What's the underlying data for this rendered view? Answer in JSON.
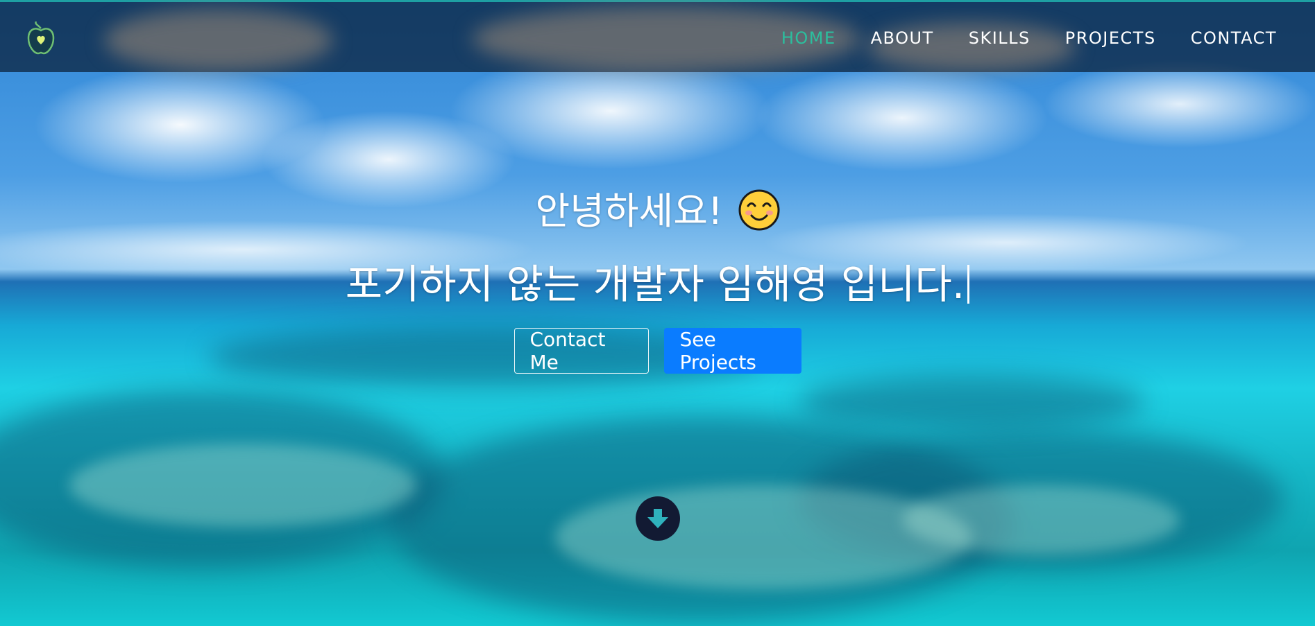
{
  "navbar": {
    "logo_icon": "apple-heart-icon",
    "links": [
      {
        "label": "HOME",
        "active": true
      },
      {
        "label": "ABOUT",
        "active": false
      },
      {
        "label": "SKILLS",
        "active": false
      },
      {
        "label": "PROJECTS",
        "active": false
      },
      {
        "label": "CONTACT",
        "active": false
      }
    ],
    "active_color": "#2bbf9e",
    "border_color": "#1e9fa3"
  },
  "hero": {
    "greeting": "안녕하세요!",
    "emoji_icon": "smiling-face-icon",
    "subtitle": "포기하지 않는 개발자 임해영 입니다.",
    "buttons": {
      "contact_label": "Contact Me",
      "projects_label": "See Projects"
    },
    "primary_color": "#0a7cff",
    "scroll_icon": "arrow-down-circle-icon"
  }
}
